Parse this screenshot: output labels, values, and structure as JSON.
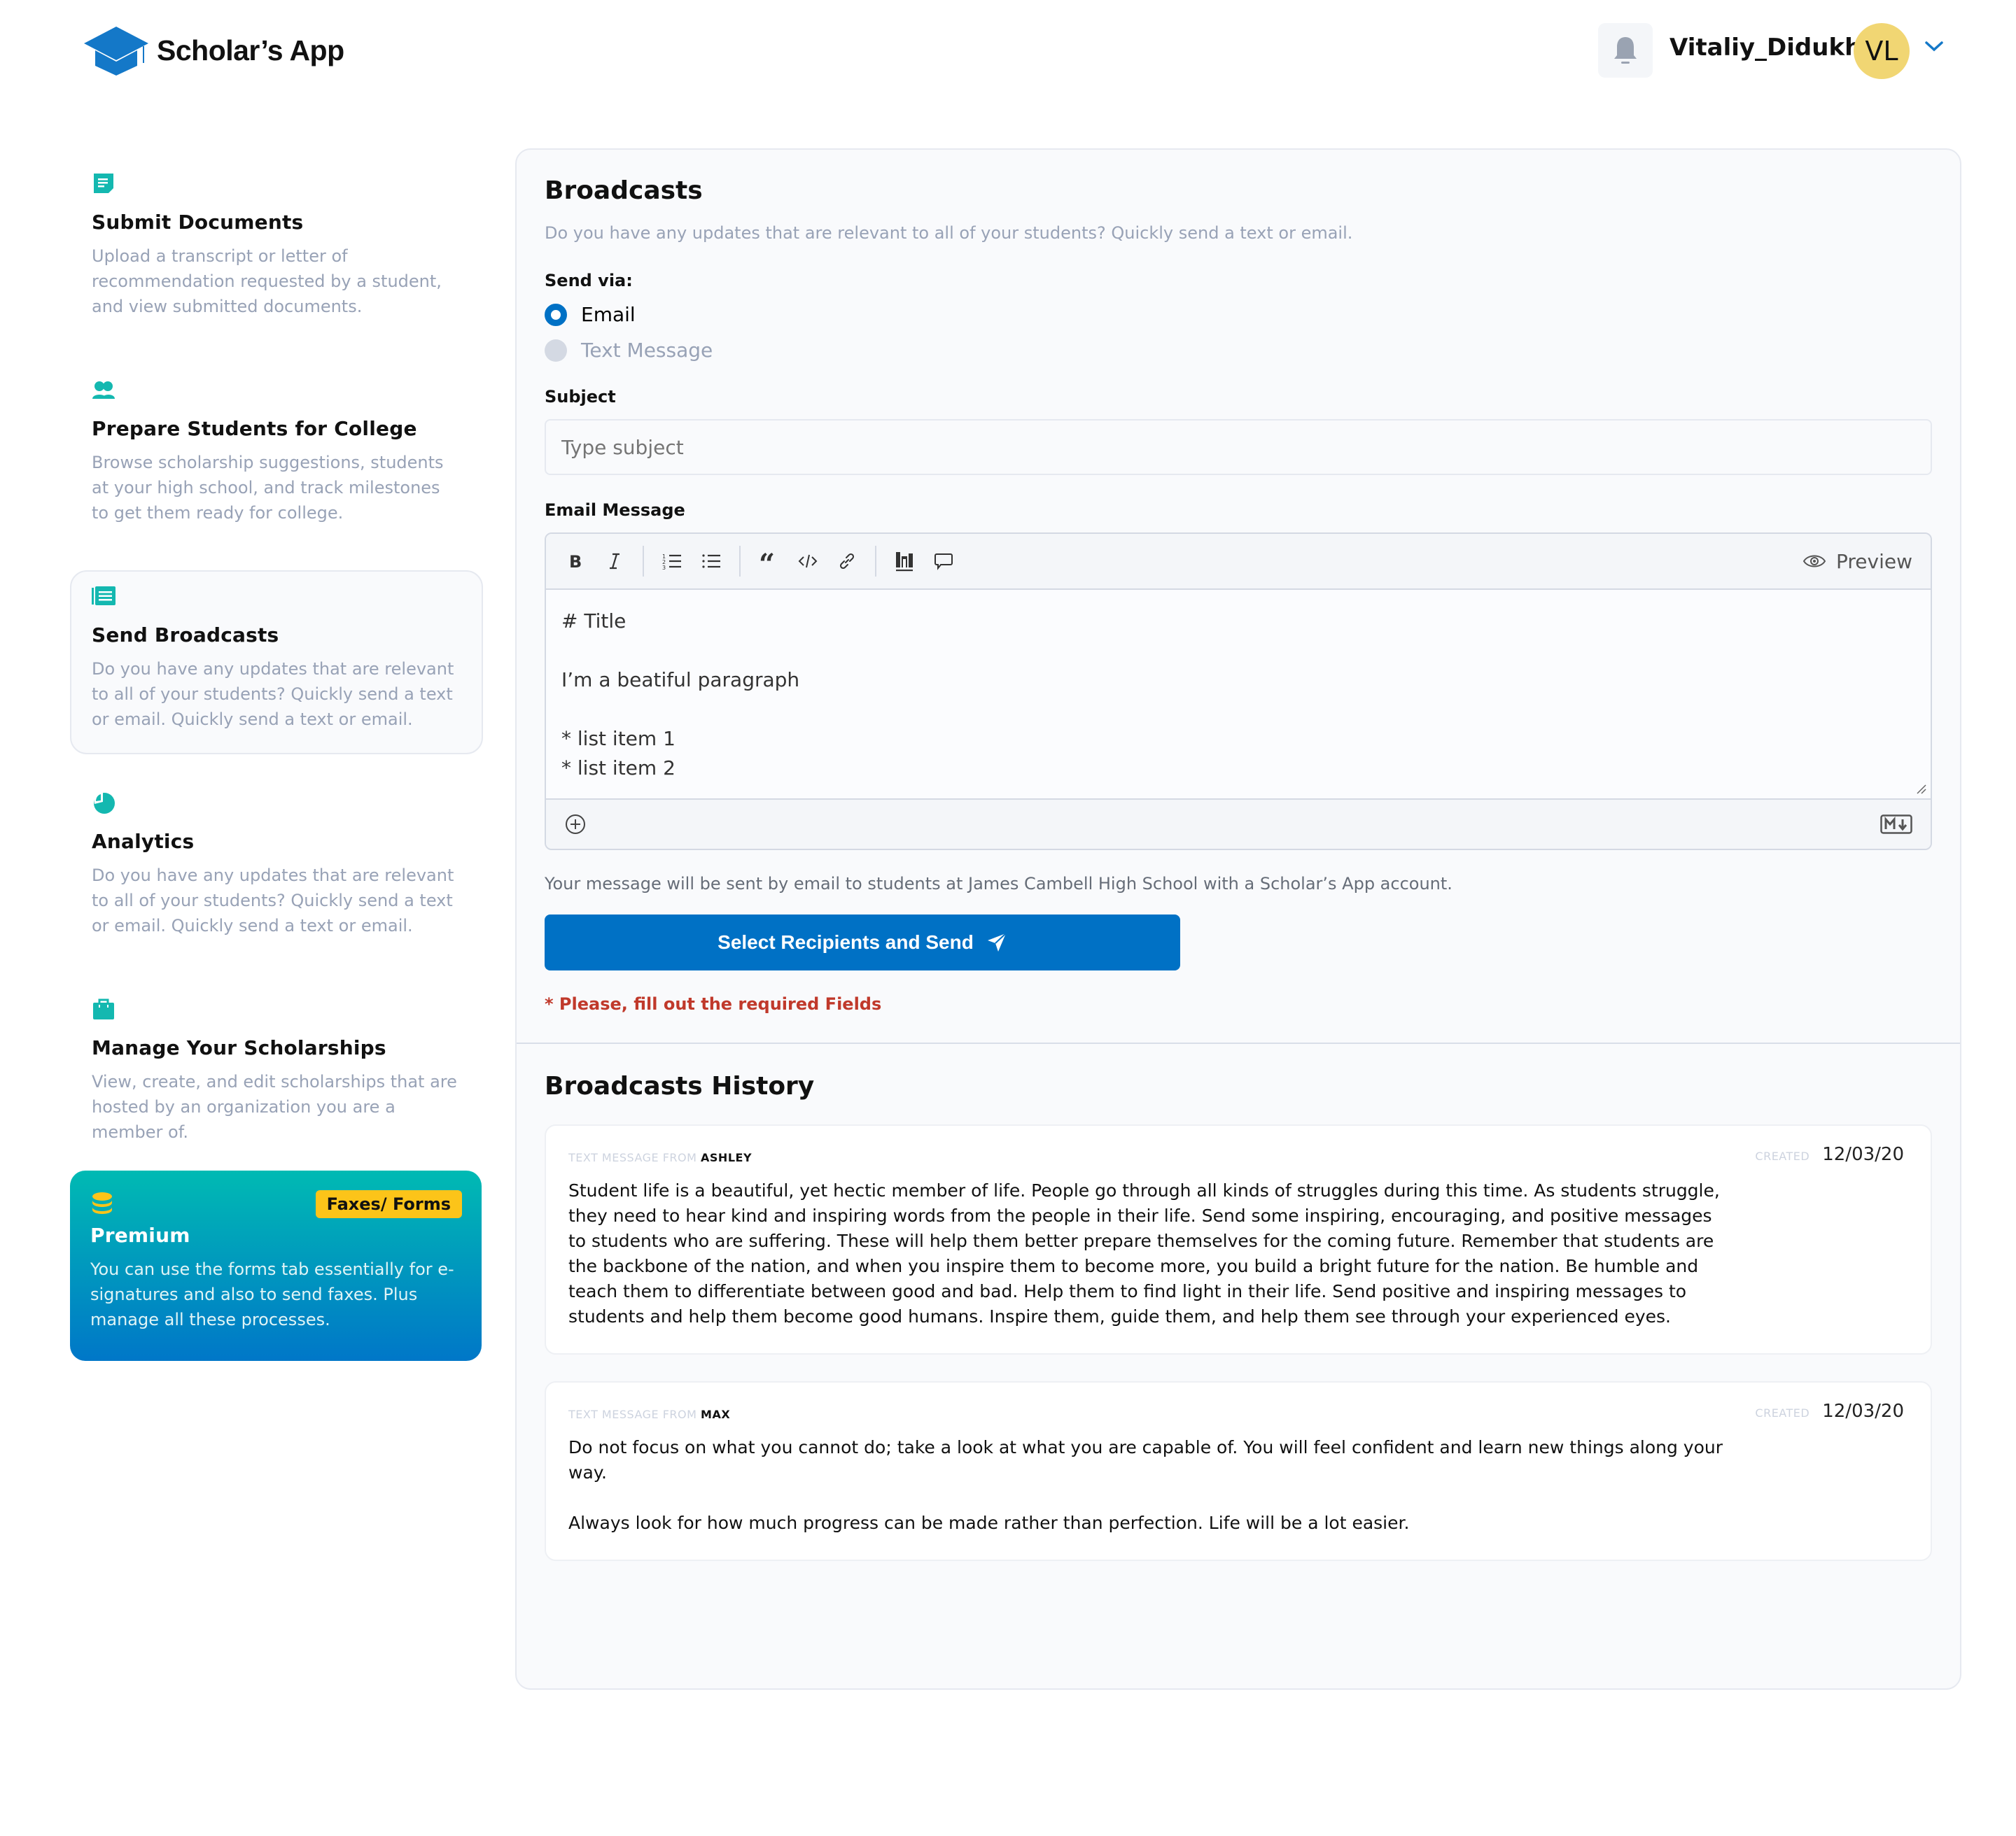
{
  "header": {
    "app_name": "Scholar’s App",
    "user_name": "Vitaliy_Didukh",
    "avatar_initials": "VL",
    "avatar_color": "#f1d673",
    "accent_color": "#0071c5"
  },
  "sidebar": {
    "items": [
      {
        "icon": "document-icon",
        "title": "Submit Documents",
        "desc": "Upload a transcript or letter of recommendation requested by a student, and view submitted documents.",
        "active": false
      },
      {
        "icon": "users-icon",
        "title": "Prepare Students for College",
        "desc": "Browse scholarship suggestions, students at your high school, and track milestones to get them ready for college.",
        "active": false
      },
      {
        "icon": "newspaper-icon",
        "title": "Send Broadcasts",
        "desc": "Do you have any updates that are relevant to all of your students? Quickly send a text or email. Quickly send a text or email.",
        "active": true
      },
      {
        "icon": "pie-chart-icon",
        "title": "Analytics",
        "desc": "Do you have any updates that are relevant to all of your students? Quickly send a text or email. Quickly send a text or email.",
        "active": false
      },
      {
        "icon": "briefcase-icon",
        "title": "Manage Your Scholarships",
        "desc": "View, create, and edit scholarships that are hosted by an organization you are a member of.",
        "active": false
      }
    ],
    "premium": {
      "icon": "coins-icon",
      "badge": "Faxes/ Forms",
      "title": "Premium",
      "desc": "You can use the forms tab essentially for e-signatures and also to send faxes. Plus manage all these processes."
    }
  },
  "broadcast": {
    "title": "Broadcasts",
    "subtitle": "Do you have any updates that are relevant to all of your students? Quickly send a text or email.",
    "send_via_label": "Send via:",
    "options": [
      {
        "label": "Email",
        "selected": true
      },
      {
        "label": "Text Message",
        "selected": false
      }
    ],
    "subject_label": "Subject",
    "subject_value": "",
    "subject_placeholder": "Type subject",
    "message_label": "Email Message",
    "toolbar": [
      "bold",
      "italic",
      "ordered-list",
      "unordered-list",
      "quote",
      "code",
      "link",
      "image",
      "comment"
    ],
    "preview_label": "Preview",
    "message_content": "# Title\n\nI’m a beatiful paragraph\n\n* list item 1\n* list item 2",
    "info": "Your message will be sent by email to students at James Cambell High School with a Scholar’s App account.",
    "send_button": "Select Recipients and Send",
    "error": "* Please, fill out the required Fields"
  },
  "history": {
    "title": "Broadcasts History",
    "from_prefix": "Text message from",
    "created_label": "Created",
    "messages": [
      {
        "from": "ASHLEY",
        "created": "12/03/20",
        "body": "Student life is a beautiful, yet hectic member of life. People go through all kinds of struggles during this time. As students struggle, they need to hear kind and inspiring words from the people in their life. Send some inspiring, encouraging, and positive messages to students who are suffering. These will help them better prepare themselves for the coming future. Remember that students are the backbone of the nation, and when you inspire them to become more, you build a bright future for the nation. Be humble and teach them to differentiate between good and bad. Help them to find light in their life. Send positive and inspiring messages to students and help them become good humans. Inspire them, guide them, and help them see through your experienced eyes."
      },
      {
        "from": "MAX",
        "created": "12/03/20",
        "body": "Do not focus on what you cannot do; take a look at what you are capable of. You will feel confident and learn new things along your way.\n\nAlways look for how much progress can be made rather than perfection. Life will be a lot easier."
      }
    ]
  }
}
